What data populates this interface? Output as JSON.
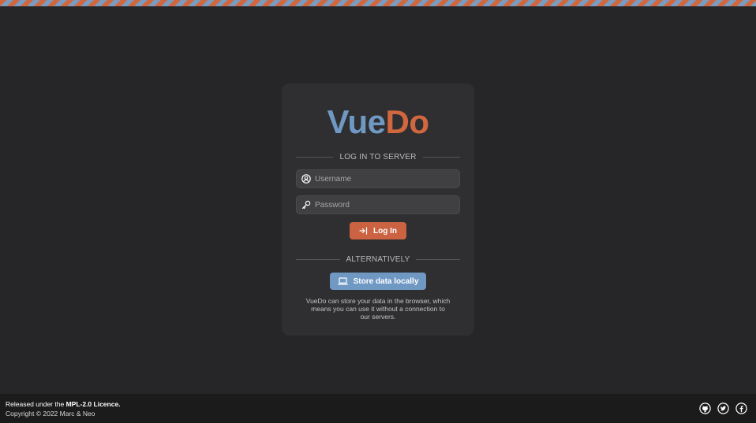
{
  "brand": {
    "part1": "Vue",
    "part2": "Do",
    "color_primary": "#6f98c3",
    "color_accent": "#d0673f"
  },
  "login_section": {
    "heading": "LOG IN TO SERVER",
    "username": {
      "value": "",
      "placeholder": "Username",
      "icon": "user-circle-icon"
    },
    "password": {
      "value": "",
      "placeholder": "Password",
      "icon": "key-icon"
    },
    "login_button": {
      "label": "Log In",
      "icon": "login-arrow-icon"
    }
  },
  "alternative_section": {
    "heading": "ALTERNATIVELY",
    "local_button": {
      "label": "Store data locally",
      "icon": "laptop-icon"
    },
    "description": "VueDo can store your data in the browser, which means you can use it without a connection to our servers."
  },
  "footer": {
    "license_prefix": "Released under the ",
    "license_name": "MPL-2.0 Licence.",
    "copyright": "Copyright © 2022 Marc & Neo",
    "social": [
      {
        "icon": "github-icon"
      },
      {
        "icon": "twitter-icon"
      },
      {
        "icon": "facebook-icon"
      }
    ]
  },
  "colors": {
    "background": "#262628",
    "card": "#2f2f31",
    "footer": "#1b1b1c",
    "stripe_a": "#d0673f",
    "stripe_b": "#7a9cc0"
  }
}
